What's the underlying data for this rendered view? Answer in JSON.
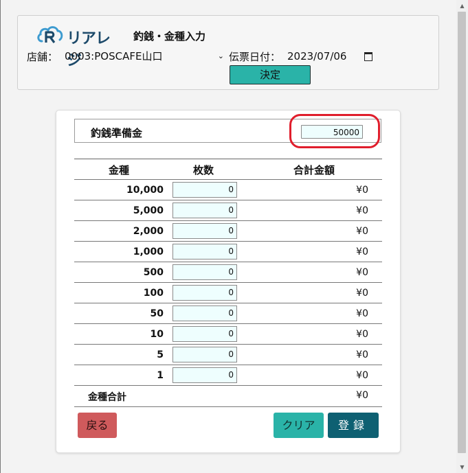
{
  "header": {
    "brand": "リアレジ",
    "page_title": "釣銭・金種入力",
    "store_label": "店舗：",
    "store_value": "0003:POSCAFE山口",
    "date_label": "伝票日付：",
    "date_value": "2023/07/06",
    "decide_label": "決定"
  },
  "reserve": {
    "label": "釣銭準備金",
    "value": "50000"
  },
  "table": {
    "headers": [
      "金種",
      "枚数",
      "合計金額"
    ],
    "rows": [
      {
        "denom": "10,000",
        "count": "0",
        "amount": "¥0"
      },
      {
        "denom": "5,000",
        "count": "0",
        "amount": "¥0"
      },
      {
        "denom": "2,000",
        "count": "0",
        "amount": "¥0"
      },
      {
        "denom": "1,000",
        "count": "0",
        "amount": "¥0"
      },
      {
        "denom": "500",
        "count": "0",
        "amount": "¥0"
      },
      {
        "denom": "100",
        "count": "0",
        "amount": "¥0"
      },
      {
        "denom": "50",
        "count": "0",
        "amount": "¥0"
      },
      {
        "denom": "10",
        "count": "0",
        "amount": "¥0"
      },
      {
        "denom": "5",
        "count": "0",
        "amount": "¥0"
      },
      {
        "denom": "1",
        "count": "0",
        "amount": "¥0"
      }
    ],
    "total_label": "金種合計",
    "total_amount": "¥0"
  },
  "buttons": {
    "back": "戻る",
    "clear": "クリア",
    "register": "登録"
  },
  "colors": {
    "accent_teal": "#2ab3a8",
    "register_blue": "#0e6072",
    "back_red": "#cf5a5c",
    "highlight_red": "#e01e2c",
    "input_bg": "#eefefe"
  }
}
